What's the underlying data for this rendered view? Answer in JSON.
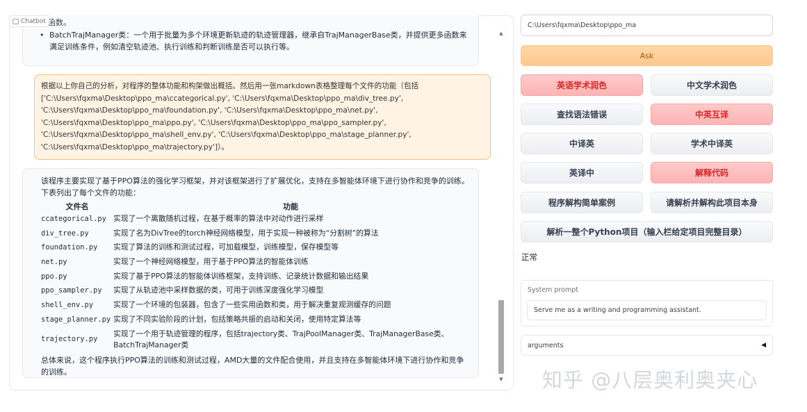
{
  "chatbot": {
    "tag_label": "Chatbot",
    "bot_top": {
      "line1": "性等函数。",
      "bullet": "BatchTrajManager类：一个用于批量为多个环境更新轨迹的轨迹管理器，继承自TrajManagerBase类，并提供更多函数来满足训练条件，例如清空轨迹池、执行训练和判断训练是否可以执行等。"
    },
    "user_msg": [
      "根据以上你自己的分析，对程序的整体功能和构架做出概括。然后用一张markdown表格整理每个文件的功能（包括",
      "['C:\\Users\\fqxma\\Desktop\\ppo_ma\\ccategorical.py', 'C:\\Users\\fqxma\\Desktop\\ppo_ma\\div_tree.py',",
      "'C:\\Users\\fqxma\\Desktop\\ppo_ma\\foundation.py', 'C:\\Users\\fqxma\\Desktop\\ppo_ma\\net.py',",
      "'C:\\Users\\fqxma\\Desktop\\ppo_ma\\ppo.py', 'C:\\Users\\fqxma\\Desktop\\ppo_ma\\ppo_sampler.py',",
      "'C:\\Users\\fqxma\\Desktop\\ppo_ma\\shell_env.py', 'C:\\Users\\fqxma\\Desktop\\ppo_ma\\stage_planner.py',",
      "'C:\\Users\\fqxma\\Desktop\\ppo_ma\\trajectory.py']）。"
    ],
    "bot_reply": {
      "intro": "该程序主要实现了基于PPO算法的强化学习框架，并对该框架进行了扩展优化，支持在多智能体环境下进行协作和竞争的训练。下表列出了每个文件的功能：",
      "table_headers": [
        "文件名",
        "功能"
      ],
      "rows": [
        {
          "file": "ccategorical.py",
          "desc": "实现了一个离散随机过程，在基于概率的算法中对动作进行采样"
        },
        {
          "file": "div_tree.py",
          "desc": "实现了名为DivTree的torch神经网络模型，用于实现一种被称为“分割树”的算法"
        },
        {
          "file": "foundation.py",
          "desc": "实现了算法的训练和测试过程，可加载模型，训练模型，保存模型等"
        },
        {
          "file": "net.py",
          "desc": "实现了一个神经网络模型，用于基于PPO算法的智能体训练"
        },
        {
          "file": "ppo.py",
          "desc": "实现了基于PPO算法的智能体训练框架，支持训练、记录统计数据和输出结果"
        },
        {
          "file": "ppo_sampler.py",
          "desc": "实现了从轨迹池中采样数据的类，可用于训练深度强化学习模型"
        },
        {
          "file": "shell_env.py",
          "desc": "实现了一个环境的包装器，包含了一些实用函数和类，用于解决重复观测缓存的问题"
        },
        {
          "file": "stage_planner.py",
          "desc": "实现了不同实验阶段的计划，包括策略共振的启动和关闭，使用特定算法等"
        },
        {
          "file": "trajectory.py",
          "desc": "实现了一个用于轨迹管理的程序，包括trajectory类、TrajPoolManager类、TrajManagerBase类、BatchTrajManager类"
        }
      ],
      "summary": "总体来说，这个程序执行PPO算法的训练和测试过程，AMD大量的文件配合使用，并且支持在多智能体环境下进行协作和竞争的训练。"
    },
    "scroll": {
      "up_glyph": "▲",
      "down_glyph": "▼"
    }
  },
  "controls": {
    "path_value": "C:\\Users\\fqxma\\Desktop\\ppo_ma",
    "ask_label": "Ask",
    "buttons": [
      {
        "label": "英语学术润色",
        "style": "red"
      },
      {
        "label": "中文学术润色",
        "style": "grey"
      },
      {
        "label": "查找语法错误",
        "style": "grey"
      },
      {
        "label": "中英互译",
        "style": "red"
      },
      {
        "label": "中译英",
        "style": "grey"
      },
      {
        "label": "学术中译英",
        "style": "grey"
      },
      {
        "label": "英译中",
        "style": "grey"
      },
      {
        "label": "解释代码",
        "style": "red"
      },
      {
        "label": "程序解构简单案例",
        "style": "grey"
      },
      {
        "label": "请解析并解构此项目本身",
        "style": "grey"
      },
      {
        "label": "解析一整个Python项目（输入栏给定项目完整目录）",
        "style": "grey"
      }
    ],
    "status": "正常",
    "system_prompt": {
      "label": "System prompt",
      "value": "Serve me as a writing and programming assistant."
    },
    "arguments": {
      "label": "arguments",
      "toggle_glyph": "◀"
    }
  },
  "watermark": "知乎 @八层奥利奥夹心",
  "colors": {
    "accent_orange": "#ffc98d",
    "accent_red": "#fecaca",
    "red_text": "#dc2626"
  }
}
